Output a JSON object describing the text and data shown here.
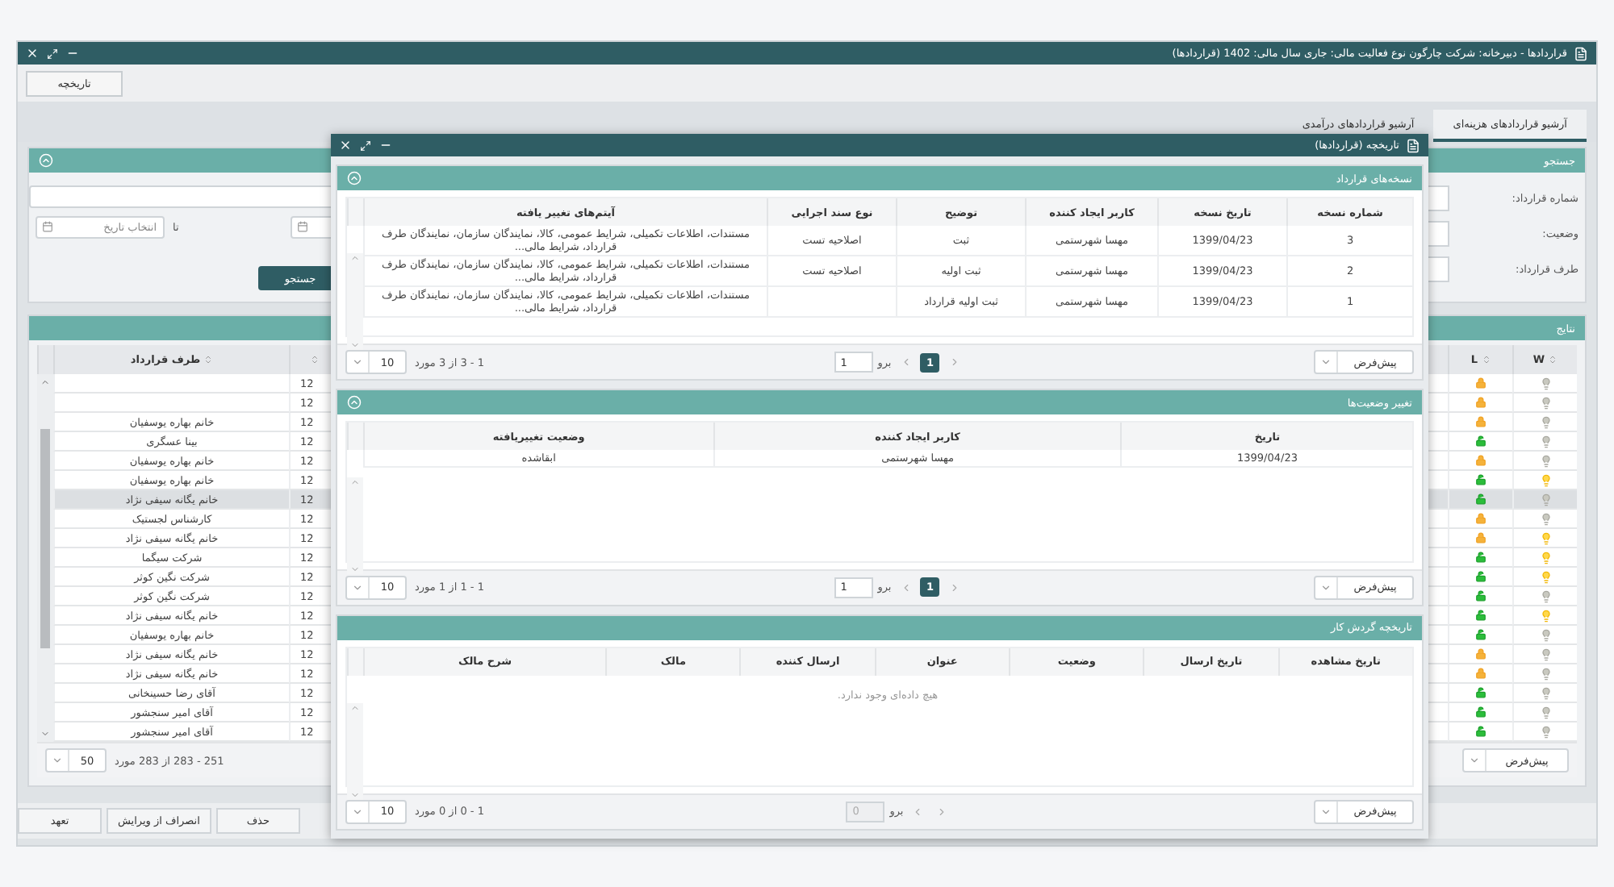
{
  "window": {
    "title": "قراردادها - دبیرخانه: شرکت چارگون نوع فعالیت مالی: جاری سال مالی: 1402 (قراردادها)"
  },
  "toolbar": {
    "buttons": [
      "تاریخچه"
    ]
  },
  "tabs": [
    {
      "label": "آرشیو قراردادهای هزینه‌ای",
      "selected": true
    },
    {
      "label": "آرشیو قراردادهای درآمدی",
      "selected": false
    }
  ],
  "search_panel": {
    "title": "جستجو",
    "labels": [
      "شماره قرارداد:",
      "وضعیت:",
      "طرف قرارداد:"
    ],
    "date_placeholder": "انتخاب تاریخ",
    "to_label": "تا",
    "search_button": "جستجو"
  },
  "results": {
    "title": "نتایج",
    "columns": [
      "W",
      "L",
      "طرف قرارداد"
    ],
    "rows": [
      {
        "lamp_on": false,
        "locked": true,
        "cell_3": "12",
        "party": "",
        "selected": false
      },
      {
        "lamp_on": false,
        "locked": true,
        "cell_3": "12",
        "party": "",
        "selected": false
      },
      {
        "lamp_on": false,
        "locked": true,
        "cell_3": "12",
        "party": "خانم بهاره یوسفیان",
        "selected": false
      },
      {
        "lamp_on": false,
        "locked": false,
        "cell_3": "12",
        "party": "بینا عسگری",
        "selected": false
      },
      {
        "lamp_on": false,
        "locked": true,
        "cell_3": "12",
        "party": "خانم بهاره یوسفیان",
        "selected": false
      },
      {
        "lamp_on": true,
        "locked": false,
        "cell_3": "12",
        "party": "خانم بهاره یوسفیان",
        "selected": false
      },
      {
        "lamp_on": false,
        "locked": false,
        "cell_3": "12",
        "party": "خانم یگانه سیفی نژاد",
        "selected": true
      },
      {
        "lamp_on": false,
        "locked": true,
        "cell_3": "12",
        "party": "کارشناس لجستیک",
        "selected": false
      },
      {
        "lamp_on": true,
        "locked": true,
        "cell_3": "12",
        "party": "خانم یگانه سیفی نژاد",
        "selected": false
      },
      {
        "lamp_on": true,
        "locked": false,
        "cell_3": "12",
        "party": "شرکت سیگما",
        "selected": false
      },
      {
        "lamp_on": true,
        "locked": false,
        "cell_3": "12",
        "party": "شرکت نگین کوثر",
        "selected": false
      },
      {
        "lamp_on": false,
        "locked": false,
        "cell_3": "12",
        "party": "شرکت نگین کوثر",
        "selected": false
      },
      {
        "lamp_on": true,
        "locked": false,
        "cell_3": "12",
        "party": "خانم یگانه سیفی نژاد",
        "selected": false
      },
      {
        "lamp_on": false,
        "locked": false,
        "cell_3": "12",
        "party": "خانم بهاره یوسفیان",
        "selected": false
      },
      {
        "lamp_on": false,
        "locked": true,
        "cell_3": "12",
        "party": "خانم یگانه سیفی نژاد",
        "selected": false
      },
      {
        "lamp_on": false,
        "locked": true,
        "cell_3": "12",
        "party": "خانم یگانه سیفی نژاد",
        "selected": false
      },
      {
        "lamp_on": false,
        "locked": false,
        "cell_3": "12",
        "party": "آقای رضا حسینخانی",
        "selected": false
      },
      {
        "lamp_on": false,
        "locked": false,
        "cell_3": "12",
        "party": "آقای امیر سنجشور",
        "selected": false
      },
      {
        "lamp_on": false,
        "locked": false,
        "cell_3": "12",
        "party": "آقای امیر سنجشور",
        "selected": false
      }
    ],
    "footer": {
      "sort": "پیش‌فرض",
      "range": "251 - 283 از 283 مورد",
      "page_size": "50"
    }
  },
  "bottom_buttons": [
    "حذف",
    "انصراف از ویرایش",
    "تعهد"
  ],
  "dialog": {
    "title": "تاریخچه (قراردادها)",
    "sections": [
      {
        "title": "نسخه‌های قرارداد",
        "collapsible": true,
        "columns": [
          "شماره نسخه",
          "تاریخ نسخه",
          "کاربر ایجاد کننده",
          "توضیح",
          "نوع سند اجرایی",
          "آیتم‌های تغییر یافته"
        ],
        "rows": [
          {
            "cells": [
              "3",
              "1399/04/23",
              "مهسا شهرستمی",
              "ثبت",
              "اصلاحیه تست",
              "مستندات، اطلاعات تکمیلی، شرایط عمومی، کالا، نمایندگان سازمان، نمایندگان طرف قرارداد، شرایط مالی..."
            ]
          },
          {
            "cells": [
              "2",
              "1399/04/23",
              "مهسا شهرستمی",
              "ثبت اولیه",
              "اصلاحیه تست",
              "مستندات، اطلاعات تکمیلی، شرایط عمومی، کالا، نمایندگان سازمان، نمایندگان طرف قرارداد، شرایط مالی..."
            ]
          },
          {
            "cells": [
              "1",
              "1399/04/23",
              "مهسا شهرستمی",
              "ثبت اولیه قرارداد",
              "",
              "مستندات، اطلاعات تکمیلی، شرایط عمومی، کالا، نمایندگان سازمان، نمایندگان طرف قرارداد، شرایط مالی..."
            ]
          }
        ],
        "footer": {
          "sort": "پیش‌فرض",
          "page": {
            "label": "1",
            "selected": true
          },
          "go_label": "برو",
          "go_value": "1",
          "go_disabled": false,
          "range": "1 - 3 از 3 مورد",
          "page_size": "10"
        }
      },
      {
        "title": "تغییر وضعیت‌ها",
        "collapsible": true,
        "columns": [
          "تاریخ",
          "کاربر ایجاد کننده",
          "وضعیت تغییریافته"
        ],
        "rows": [
          {
            "cells": [
              "1399/04/23",
              "مهسا شهرستمی",
              "ابقاشده"
            ]
          }
        ],
        "footer": {
          "sort": "پیش‌فرض",
          "page": {
            "label": "1",
            "selected": true
          },
          "go_label": "برو",
          "go_value": "1",
          "go_disabled": false,
          "range": "1 - 1 از 1 مورد",
          "page_size": "10"
        }
      },
      {
        "title": "تاریخچه گردش کار",
        "collapsible": false,
        "columns": [
          "تاریخ مشاهده",
          "تاریخ ارسال",
          "وضعیت",
          "عنوان",
          "ارسال کننده",
          "مالک",
          "شرح مالک"
        ],
        "empty_text": "هیچ داده‌ای وجود ندارد.",
        "footer": {
          "sort": "پیش‌فرض",
          "go_label": "برو",
          "go_value": "0",
          "go_disabled": true,
          "range": "1 - 0 از 0 مورد",
          "page_size": "10"
        }
      }
    ]
  }
}
